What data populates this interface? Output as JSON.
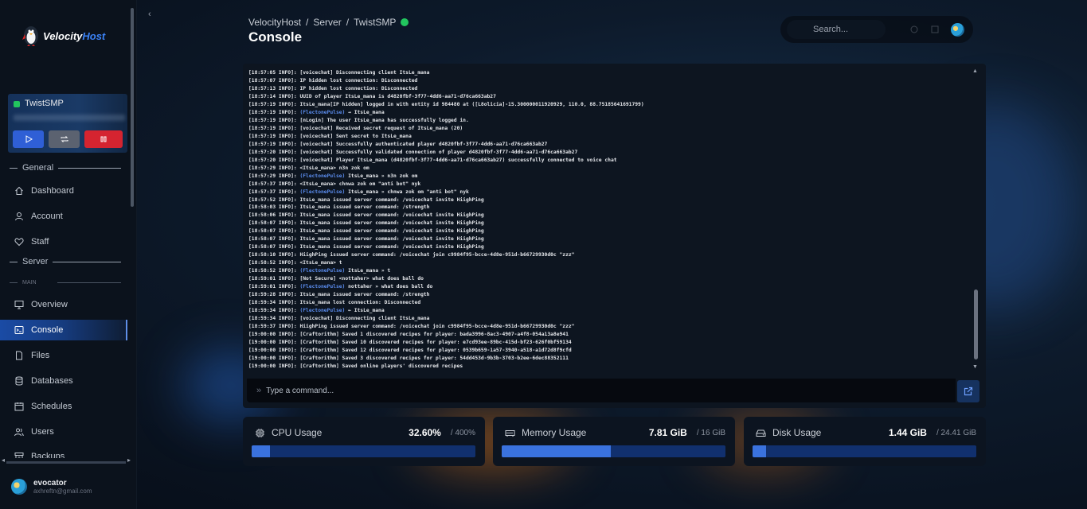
{
  "brand": {
    "name_part1": "Velocity",
    "name_part2": "Host"
  },
  "server_card": {
    "name": "TwistSMP",
    "buttons": {
      "start": "start",
      "restart": "restart",
      "stop": "stop"
    }
  },
  "sidebar": {
    "section_general": "General",
    "section_server": "Server",
    "section_main": "MAIN",
    "items": [
      {
        "label": "Dashboard",
        "icon": "home-icon"
      },
      {
        "label": "Account",
        "icon": "user-icon"
      },
      {
        "label": "Staff",
        "icon": "heart-handshake-icon"
      },
      {
        "label": "Overview",
        "icon": "monitor-icon"
      },
      {
        "label": "Console",
        "icon": "terminal-icon",
        "active": true
      },
      {
        "label": "Files",
        "icon": "file-icon"
      },
      {
        "label": "Databases",
        "icon": "database-icon"
      },
      {
        "label": "Schedules",
        "icon": "calendar-icon"
      },
      {
        "label": "Users",
        "icon": "users-icon"
      },
      {
        "label": "Backups",
        "icon": "archive-icon"
      }
    ]
  },
  "user": {
    "name": "evocator",
    "email": "axhreftn@gmail.com"
  },
  "breadcrumb": {
    "part1": "VelocityHost",
    "sep": "/",
    "part2": "Server",
    "part3": "TwistSMP"
  },
  "page_title": "Console",
  "search": {
    "placeholder": "Search..."
  },
  "console": {
    "lines": [
      {
        "t": "[18:57:05 INFO]:",
        "m": " [voicechat] Disconnecting client ItsLe_mana"
      },
      {
        "t": "[18:57:07 INFO]:",
        "m": " IP hidden lost connection: Disconnected"
      },
      {
        "t": "[18:57:13 INFO]:",
        "m": " IP hidden lost connection: Disconnected"
      },
      {
        "t": "[18:57:14 INFO]:",
        "m": " UUID of player ItsLe_mana is d4820fbf-3f77-4dd6-aa71-d76ca663ab27"
      },
      {
        "t": "[18:57:19 INFO]:",
        "m": " ItsLe_mana[IP hidden] logged in with entity id 984480 at ([L8olicia]-15.300000011920929, 110.0, 88.75185641691799)"
      },
      {
        "t": "[18:57:19 INFO]:",
        "p": " (FlectonePulse)",
        "m": " → ItsLe_mana"
      },
      {
        "t": "[18:57:19 INFO]:",
        "m": " [nLogin] The user ItsLe_mana has successfully logged in."
      },
      {
        "t": "[18:57:19 INFO]:",
        "m": " [voicechat] Received secret request of ItsLe_mana (20)"
      },
      {
        "t": "[18:57:19 INFO]:",
        "m": " [voicechat] Sent secret to ItsLe_mana"
      },
      {
        "t": "[18:57:19 INFO]:",
        "m": " [voicechat] Successfully authenticated player d4820fbf-3f77-4dd6-aa71-d76ca663ab27"
      },
      {
        "t": "[18:57:20 INFO]:",
        "m": " [voicechat] Successfully validated connection of player d4820fbf-3f77-4dd6-aa71-d76ca663ab27"
      },
      {
        "t": "[18:57:20 INFO]:",
        "m": " [voicechat] Player ItsLe_mana (d4820fbf-3f77-4dd6-aa71-d76ca663ab27) successfully connected to voice chat"
      },
      {
        "t": "[18:57:29 INFO]:",
        "m": " <ItsLe_mana> n3n zok om"
      },
      {
        "t": "[18:57:29 INFO]:",
        "p": " (FlectonePulse)",
        "m": " ItsLe_mana » n3n zok om"
      },
      {
        "t": "[18:57:37 INFO]:",
        "m": " <ItsLe_mana> chnwa zok om \"anti bot\" nyk"
      },
      {
        "t": "[18:57:37 INFO]:",
        "p": " (FlectonePulse)",
        "m": " ItsLe_mana » chnwa zok om \"anti bot\" nyk"
      },
      {
        "t": "[18:57:52 INFO]:",
        "m": " ItsLe_mana issued server command: /voicechat invite HiighPing"
      },
      {
        "t": "[18:58:03 INFO]:",
        "m": " ItsLe_mana issued server command: /strength"
      },
      {
        "t": "[18:58:06 INFO]:",
        "m": " ItsLe_mana issued server command: /voicechat invite HiighPing"
      },
      {
        "t": "[18:58:07 INFO]:",
        "m": " ItsLe_mana issued server command: /voicechat invite HiighPing"
      },
      {
        "t": "[18:58:07 INFO]:",
        "m": " ItsLe_mana issued server command: /voicechat invite HiighPing"
      },
      {
        "t": "[18:58:07 INFO]:",
        "m": " ItsLe_mana issued server command: /voicechat invite HiighPing"
      },
      {
        "t": "[18:58:07 INFO]:",
        "m": " ItsLe_mana issued server command: /voicechat invite HiighPing"
      },
      {
        "t": "[18:58:10 INFO]:",
        "m": " HiighPing issued server command: /voicechat join c9984f95-bcce-4d8e-951d-b66729930d0c \"zzz\""
      },
      {
        "t": "[18:58:52 INFO]:",
        "m": " <ItsLe_mana> t"
      },
      {
        "t": "[18:58:52 INFO]:",
        "p": " (FlectonePulse)",
        "m": " ItsLe_mana » t"
      },
      {
        "t": "[18:59:01 INFO]:",
        "m": " [Not Secure] <nottaher> what does ball do"
      },
      {
        "t": "[18:59:01 INFO]:",
        "p": " (FlectonePulse)",
        "m": " nottaher » what does ball do"
      },
      {
        "t": "[18:59:28 INFO]:",
        "m": " ItsLe_mana issued server command: /strength"
      },
      {
        "t": "[18:59:34 INFO]:",
        "m": " ItsLe_mana lost connection: Disconnected"
      },
      {
        "t": "[18:59:34 INFO]:",
        "p": " (FlectonePulse)",
        "m": " ← ItsLe_mana"
      },
      {
        "t": "[18:59:34 INFO]:",
        "m": " [voicechat] Disconnecting client ItsLe_mana"
      },
      {
        "t": "[18:59:37 INFO]:",
        "m": " HiighPing issued server command: /voicechat join c9984f95-bcce-4d8e-951d-b66729930d0c \"zzz\""
      },
      {
        "t": "[19:00:00 INFO]:",
        "m": " [Craftorithm] Saved 1 discovered recipes for player: bada3996-8ac3-4907-a4f8-054a13a8e941"
      },
      {
        "t": "[19:00:00 INFO]:",
        "m": " [Craftorithm] Saved 10 discovered recipes for player: e7cd93ee-89bc-415d-bf23-626f0bf59134"
      },
      {
        "t": "[19:00:00 INFO]:",
        "m": " [Craftorithm] Saved 12 discovered recipes for player: 0539b659-1a57-3940-a518-a1d72d8f9cfd"
      },
      {
        "t": "[19:00:00 INFO]:",
        "m": " [Craftorithm] Saved 3 discovered recipes for player: 54dd453d-9b3b-3703-b2ee-6dec88352111"
      },
      {
        "t": "[19:00:00 INFO]:",
        "m": " [Craftorithm] Saved online players' discovered recipes"
      }
    ],
    "command_placeholder": "Type a command..."
  },
  "stats": {
    "cpu": {
      "label": "CPU Usage",
      "value": "32.60%",
      "max": "/ 400%",
      "fraction": 0.0815
    },
    "memory": {
      "label": "Memory Usage",
      "value": "7.81 GiB",
      "max": "/ 16 GiB",
      "fraction": 0.488
    },
    "disk": {
      "label": "Disk Usage",
      "value": "1.44 GiB",
      "max": "/ 24.41 GiB",
      "fraction": 0.059
    }
  },
  "colors": {
    "accent": "#3a72de",
    "online": "#22c55e",
    "stop": "#d52430"
  }
}
